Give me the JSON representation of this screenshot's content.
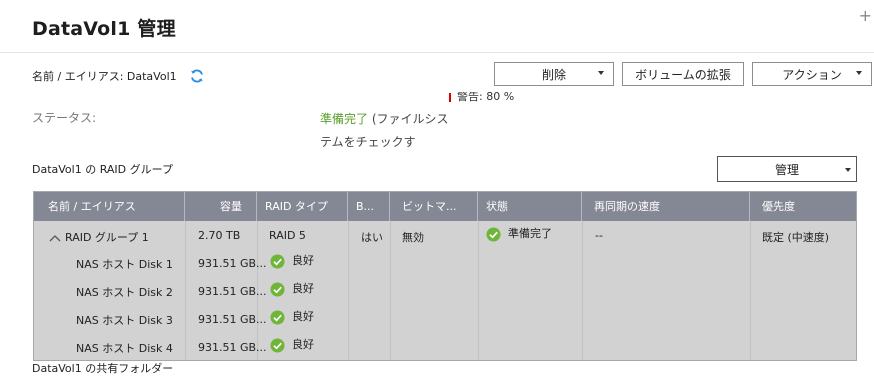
{
  "window": {
    "title": "DataVol1  管理"
  },
  "info": {
    "name_label": "名前 / エイリアス: DataVol1"
  },
  "toolbar": {
    "delete_label": "削除",
    "expand_label": "ボリュームの拡張",
    "action_label": "アクション"
  },
  "status": {
    "label": "ステータス:",
    "value_ok": "準備完了",
    "value_rest": " (ファイルシステムをチェックす",
    "warning": "警告: 80 %"
  },
  "raid_section": {
    "title": "DataVol1 の RAID グループ",
    "manage_label": "管理"
  },
  "table": {
    "headers": [
      "名前 / エイリアス",
      "容量",
      "RAID タイプ",
      "B...",
      "ビットマ...",
      "状態",
      "再同期の速度",
      "優先度"
    ],
    "group_row": {
      "name": "RAID グループ 1",
      "capacity": "2.70 TB",
      "raid_type": "RAID 5",
      "b": "はい",
      "bitmap": "無効",
      "state": "準備完了",
      "resync": "--",
      "priority": "既定 (中速度)"
    },
    "disks": [
      {
        "name": "NAS ホスト Disk 1",
        "capacity": "931.51 GB...",
        "status": "良好"
      },
      {
        "name": "NAS ホスト Disk 2",
        "capacity": "931.51 GB...",
        "status": "良好"
      },
      {
        "name": "NAS ホスト Disk 3",
        "capacity": "931.51 GB...",
        "status": "良好"
      },
      {
        "name": "NAS ホスト Disk 4",
        "capacity": "931.51 GB...",
        "status": "良好"
      }
    ]
  },
  "shared_section": {
    "title": "DataVol1 の共有フォルダー"
  },
  "colors": {
    "ok_green": "#5a9e2e",
    "header_gray": "#848894",
    "refresh_blue": "#2b8ee0",
    "warning_red": "#d40000"
  }
}
